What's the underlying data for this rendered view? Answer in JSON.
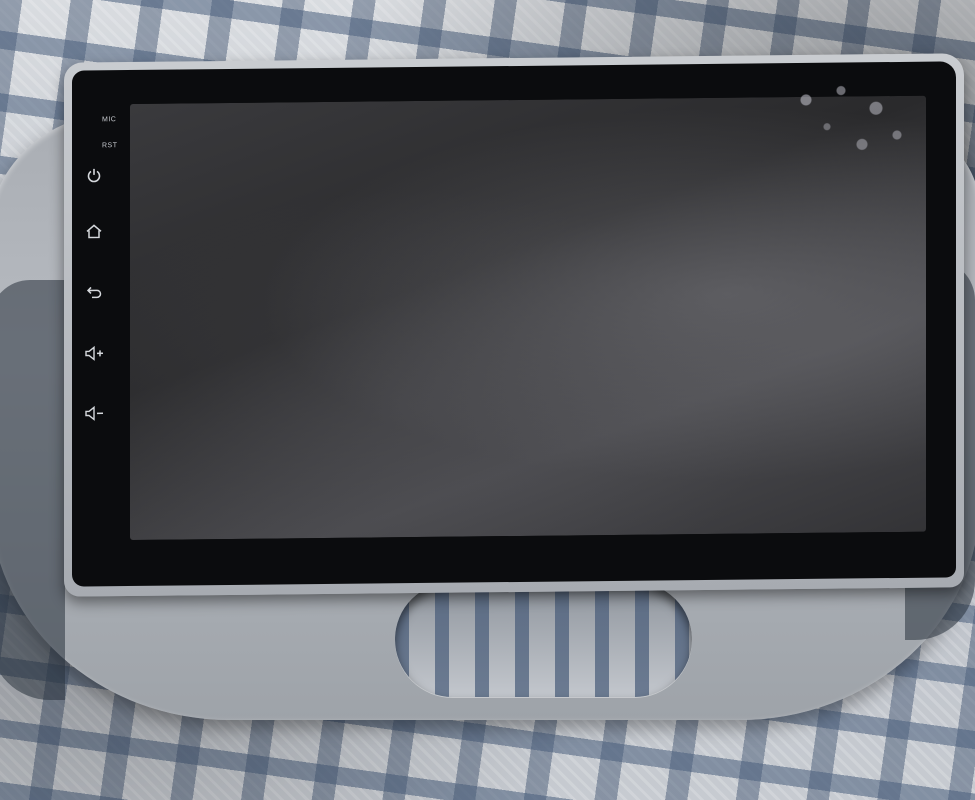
{
  "device": {
    "labels": {
      "mic": "MIC",
      "rst": "RST"
    },
    "buttons": [
      {
        "id": "power",
        "icon": "power-icon"
      },
      {
        "id": "home",
        "icon": "home-icon"
      },
      {
        "id": "back",
        "icon": "back-icon"
      },
      {
        "id": "volume_up",
        "icon": "volume-up-icon"
      },
      {
        "id": "volume_down",
        "icon": "volume-down-icon"
      }
    ]
  },
  "colors": {
    "screen": "#2f2f32",
    "bezel": "#0b0c0e",
    "trim": "#b7bbc1",
    "icon": "#d5d8dc"
  }
}
